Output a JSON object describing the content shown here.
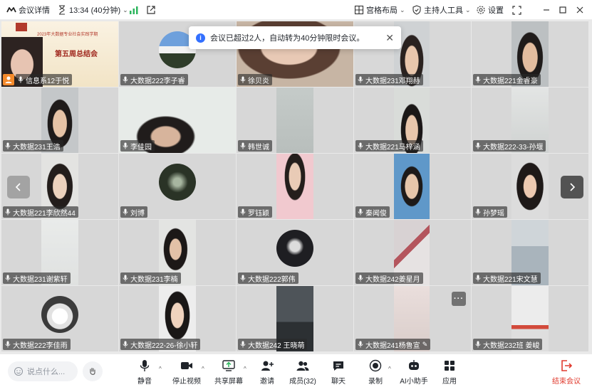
{
  "topbar": {
    "meeting_details": "会议详情",
    "time_limit": "13:34 (40分钟)",
    "layout": "宫格布局",
    "host_tools": "主持人工具",
    "settings": "设置"
  },
  "toast": {
    "message": "会议已超过2人，自动转为40分钟限时会议。"
  },
  "slide": {
    "title": "2023年大数据专业社会实践学期",
    "subtitle": "第五周总结会"
  },
  "participants": [
    "信息系12于悦",
    "大数据222李子睿",
    "徐贝炎",
    "大数据231邓翔赫",
    "大数据221金睿豪",
    "大数据231王浩",
    "李佳园",
    "韩世诚",
    "大数据221马梓涵",
    "大数据222-33-孙堰",
    "大数据221李欣然44",
    "刘博",
    "罗钰颖",
    "秦闻俊",
    "孙梦瑶",
    "大数据231谢紫轩",
    "大数据231李楠",
    "大数据222郭伟",
    "大数据242姜星月",
    "大数据221宋文慧",
    "大数据222李佳雨",
    "大数据222-26-徐小轩",
    "大数据242 王晓萌",
    "大数据241杨鲁宣",
    "大数据232班 姜峻"
  ],
  "toolbar": {
    "chat_placeholder": "说点什么...",
    "mute": "静音",
    "stop_video": "停止视频",
    "share_screen": "共享屏幕",
    "invite": "邀请",
    "members": "成员(32)",
    "chat": "聊天",
    "record": "录制",
    "ai_assistant": "AI小助手",
    "apps": "应用",
    "end_meeting": "结束会议"
  },
  "colors": {
    "accent": "#3370ff",
    "end": "#e03a2e",
    "host_badge": "#f58a2b",
    "signal": "#2db55d"
  }
}
